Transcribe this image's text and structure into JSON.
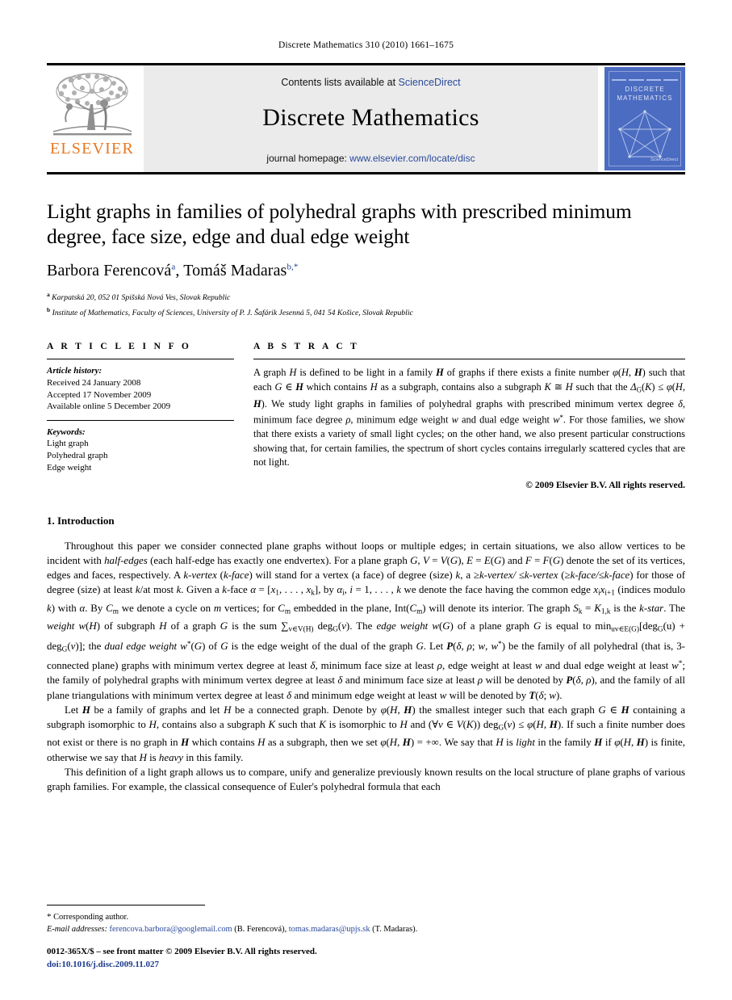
{
  "running_head": "Discrete Mathematics 310 (2010) 1661–1675",
  "masthead": {
    "contents_prefix": "Contents lists available at ",
    "contents_link": "ScienceDirect",
    "journal_name": "Discrete Mathematics",
    "homepage_prefix": "journal homepage: ",
    "homepage_link": "www.elsevier.com/locate/disc",
    "publisher_wordmark": "ELSEVIER",
    "cover": {
      "title_line1": "DISCRETE",
      "title_line2": "MATHEMATICS",
      "sciencedirect_label": "ScienceDirect"
    }
  },
  "article": {
    "title": "Light graphs in families of polyhedral graphs with prescribed minimum degree, face size, edge and dual edge weight",
    "authors": [
      {
        "name": "Barbora Ferencová",
        "marker": "a"
      },
      {
        "name": "Tomáš Madaras",
        "marker": "b,*"
      }
    ],
    "affiliations": [
      {
        "marker": "a",
        "text": "Karpatská 20, 052 01 Spišská Nová Ves, Slovak Republic"
      },
      {
        "marker": "b",
        "text": "Institute of Mathematics, Faculty of Sciences, University of P. J. Šafárik Jesenná 5, 041 54 Košice, Slovak Republic"
      }
    ]
  },
  "info": {
    "heading": "A R T I C L E    I N F O",
    "history_label": "Article history:",
    "history": [
      "Received 24 January 2008",
      "Accepted 17 November 2009",
      "Available online 5 December 2009"
    ],
    "keywords_label": "Keywords:",
    "keywords": [
      "Light graph",
      "Polyhedral graph",
      "Edge weight"
    ]
  },
  "abstract": {
    "heading": "A B S T R A C T",
    "copyright": "© 2009 Elsevier B.V. All rights reserved."
  },
  "body": {
    "section_number_title": "1. Introduction"
  },
  "footnotes": {
    "corresponding": "Corresponding author.",
    "email_label": "E-mail addresses:",
    "email1": "ferencova.barbora@googlemail.com",
    "email1_owner": "(B. Ferencová),",
    "email2": "tomas.madaras@upjs.sk",
    "email2_owner": "(T. Madaras).",
    "issn_line": "0012-365X/$ – see front matter © 2009 Elsevier B.V. All rights reserved.",
    "doi_line": "doi:10.1016/j.disc.2009.11.027"
  }
}
